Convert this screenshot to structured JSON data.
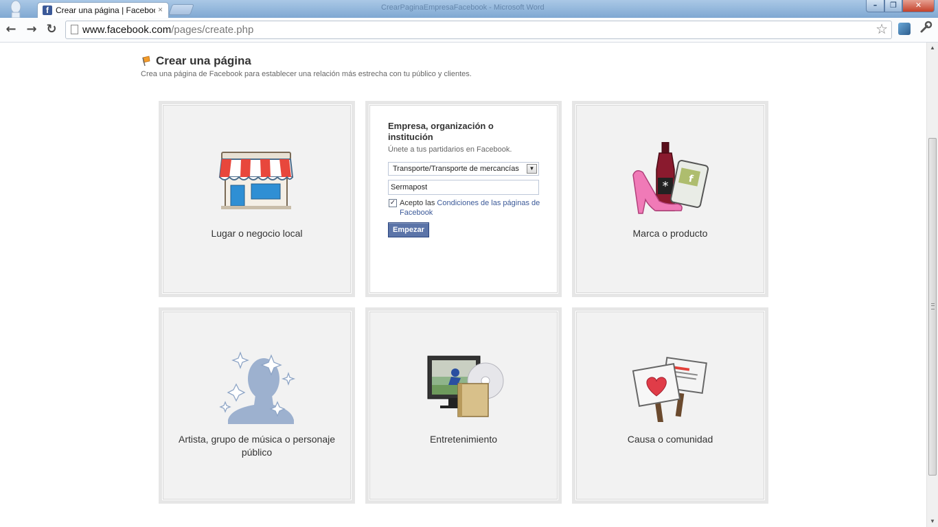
{
  "browser": {
    "tab_title": "Crear una página | Facebook",
    "tab_close": "×",
    "window_title": "CrearPaginaEmpresaFacebook - Microsoft Word",
    "url_domain": "www.facebook.com",
    "url_path": "/pages/create.php",
    "back": "←",
    "forward": "→",
    "reload": "↻",
    "bookmark": "☆",
    "wrench": "🔧",
    "minimize": "–",
    "maximize": "❐",
    "close": "✕"
  },
  "header": {
    "title": "Crear una página",
    "subtitle": "Crea una página de Facebook para establecer una relación más estrecha con tu público y clientes."
  },
  "categories": [
    {
      "label": "Lugar o negocio local",
      "icon": "storefront-icon"
    },
    {
      "label": "Empresa, organización o institución",
      "expanded": true,
      "description": "Únete a tus partidarios en Facebook.",
      "select_value": "Transporte/Transporte de mercancías",
      "name_value": "Sermapost",
      "terms_checked": true,
      "terms_prefix": "Acepto las ",
      "terms_link": "Condiciones de las páginas de Facebook",
      "button_label": "Empezar"
    },
    {
      "label": "Marca o producto",
      "icon": "brand-product-icon"
    },
    {
      "label": "Artista, grupo de música o personaje público",
      "icon": "artist-silhouette-icon"
    },
    {
      "label": "Entretenimiento",
      "icon": "entertainment-icon"
    },
    {
      "label": "Causa o comunidad",
      "icon": "protest-signs-icon"
    }
  ],
  "colors": {
    "facebook_blue": "#3b5998",
    "button_bg": "#5b74a8",
    "card_bg": "#f2f2f2"
  }
}
